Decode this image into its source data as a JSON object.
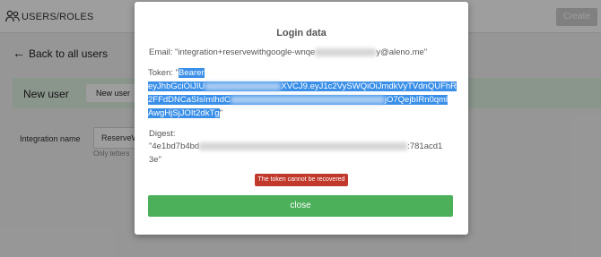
{
  "app": {
    "section_title": "USERS/ROLES",
    "create_label": "Create",
    "back_label": "Back to all users",
    "new_user_label": "New user",
    "new_user_tab": "New user",
    "integration_name_label": "Integration name",
    "integration_name_value": "ReserveW",
    "integration_hint": "Only letters"
  },
  "modal": {
    "title": "Login data",
    "email_prefix": "Email: \"integration+reservewithgoogle-wnqe",
    "email_suffix": "y@aleno.me\"",
    "token_label": "Token: \"",
    "token_line1_sel": "Bearer",
    "token_line2_start": "eyJhbGciOiJIU",
    "token_line2_end": "XVCJ9.eyJ1c2VySWQiOiJmdkVyTVdnQUFhR",
    "token_line3_start": "2FFdDNCaSIsImlhdC",
    "token_line3_end": "jO7QejbIRn0qml",
    "token_line4": "AwgHjSjJOIt2dkTg",
    "token_close_quote": "\"",
    "digest_label": "Digest:",
    "digest_start": "\"4e1bd7b4bd",
    "digest_end": ":781acd1",
    "digest_line2": "3e\"",
    "warning": "The token cannot be recovered",
    "close_label": "close"
  },
  "colors": {
    "selection": "#3a8fe8",
    "warning": "#c0392b",
    "close_button": "#4caf5a",
    "band": "#dff0e3"
  },
  "icons": {
    "users": "users-icon",
    "back": "arrow-left-icon"
  }
}
